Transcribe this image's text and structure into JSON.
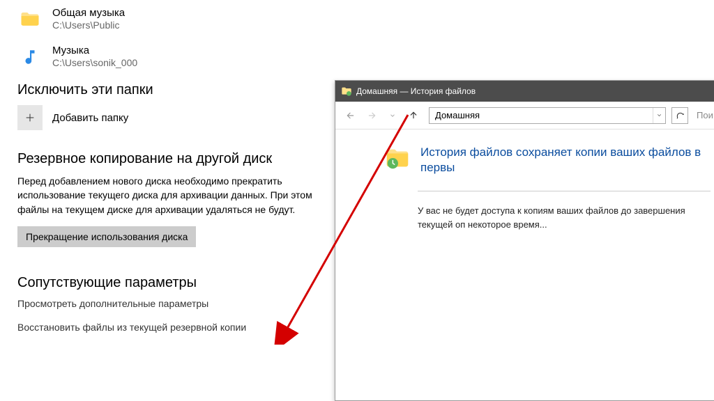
{
  "folders": [
    {
      "name": "Общая музыка",
      "path": "C:\\Users\\Public"
    },
    {
      "name": "Музыка",
      "path": "C:\\Users\\sonik_000"
    }
  ],
  "exclude": {
    "title": "Исключить эти папки",
    "add_label": "Добавить папку"
  },
  "backup": {
    "title": "Резервное копирование на другой диск",
    "desc": "Перед добавлением нового диска необходимо прекратить использование текущего диска для архивации данных. При этом файлы на текущем диске для архивации удаляться не будут.",
    "stop_label": "Прекращение использования диска"
  },
  "related": {
    "title": "Сопутствующие параметры",
    "link1": "Просмотреть дополнительные параметры",
    "link2": "Восстановить файлы из текущей резервной копии"
  },
  "window": {
    "title": "Домашняя — История файлов",
    "address": "Домашняя",
    "search_placeholder": "Пои",
    "heading": "История файлов сохраняет копии ваших файлов в первы",
    "message": "У вас не будет доступа к копиям ваших файлов до завершения текущей оп некоторое время..."
  }
}
